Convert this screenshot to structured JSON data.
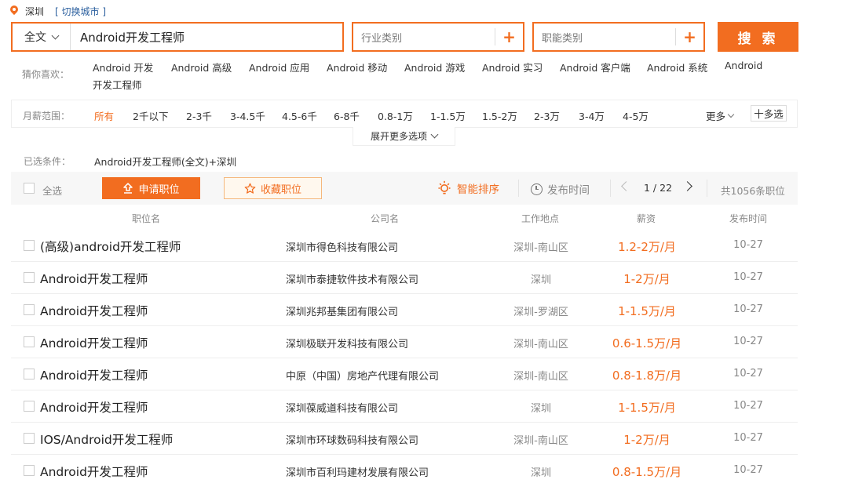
{
  "location": {
    "city": "深圳",
    "switch_label": "[ 切换城市 ]"
  },
  "search": {
    "scope": "全文",
    "keyword": "Android开发工程师",
    "industry_placeholder": "行业类别",
    "job_type_placeholder": "职能类别",
    "plus": "+",
    "button": "搜 索"
  },
  "guess": {
    "label": "猜你喜欢：",
    "items": [
      "Android 开发",
      "Android 高级",
      "Android 应用",
      "Android 移动",
      "Android 游戏",
      "Android 实习",
      "Android 客户端",
      "Android 系统",
      "Android",
      "开发工程师"
    ]
  },
  "salary": {
    "label": "月薪范围：",
    "options": [
      "所有",
      "2千以下",
      "2-3千",
      "3-4.5千",
      "4.5-6千",
      "6-8千",
      "0.8-1万",
      "1-1.5万",
      "1.5-2万",
      "2-3万",
      "3-4万",
      "4-5万"
    ],
    "more": "更多",
    "multi": "十多选",
    "expand": "展开更多选项"
  },
  "conditions": {
    "label": "已选条件：",
    "value": "Android开发工程师(全文)+深圳"
  },
  "toolbar": {
    "select_all": "全选",
    "apply": "申请职位",
    "favorite": "收藏职位",
    "smart_sort": "智能排序",
    "publish_time": "发布时间",
    "page": "1 / 22",
    "total": "共1056条职位"
  },
  "columns": [
    "职位名",
    "公司名",
    "工作地点",
    "薪资",
    "发布时间"
  ],
  "jobs": [
    {
      "title": "(高级)android开发工程师",
      "company": "深圳市得色科技有限公司",
      "location": "深圳-南山区",
      "salary": "1.2-2万/月",
      "date": "10-27"
    },
    {
      "title": "Android开发工程师",
      "company": "深圳市泰捷软件技术有限公司",
      "location": "深圳",
      "salary": "1-2万/月",
      "date": "10-27"
    },
    {
      "title": "Android开发工程师",
      "company": "深圳兆邦基集团有限公司",
      "location": "深圳-罗湖区",
      "salary": "1-1.5万/月",
      "date": "10-27"
    },
    {
      "title": "Android开发工程师",
      "company": "深圳极联开发科技有限公司",
      "location": "深圳-南山区",
      "salary": "0.6-1.5万/月",
      "date": "10-27"
    },
    {
      "title": "Android开发工程师",
      "company": "中原（中国）房地产代理有限公司",
      "location": "深圳-南山区",
      "salary": "0.8-1.8万/月",
      "date": "10-27"
    },
    {
      "title": "Android开发工程师",
      "company": "深圳葆威道科技有限公司",
      "location": "深圳",
      "salary": "1-1.5万/月",
      "date": "10-27"
    },
    {
      "title": "IOS/Android开发工程师",
      "company": "深圳市环球数码科技有限公司",
      "location": "深圳-南山区",
      "salary": "1-2万/月",
      "date": "10-27"
    },
    {
      "title": "Android开发工程师",
      "company": "深圳市百利玛建材发展有限公司",
      "location": "深圳",
      "salary": "0.8-1.5万/月",
      "date": "10-27"
    }
  ],
  "colors": {
    "accent": "#f26d20",
    "link": "#2b5f9e",
    "muted": "#888888"
  }
}
